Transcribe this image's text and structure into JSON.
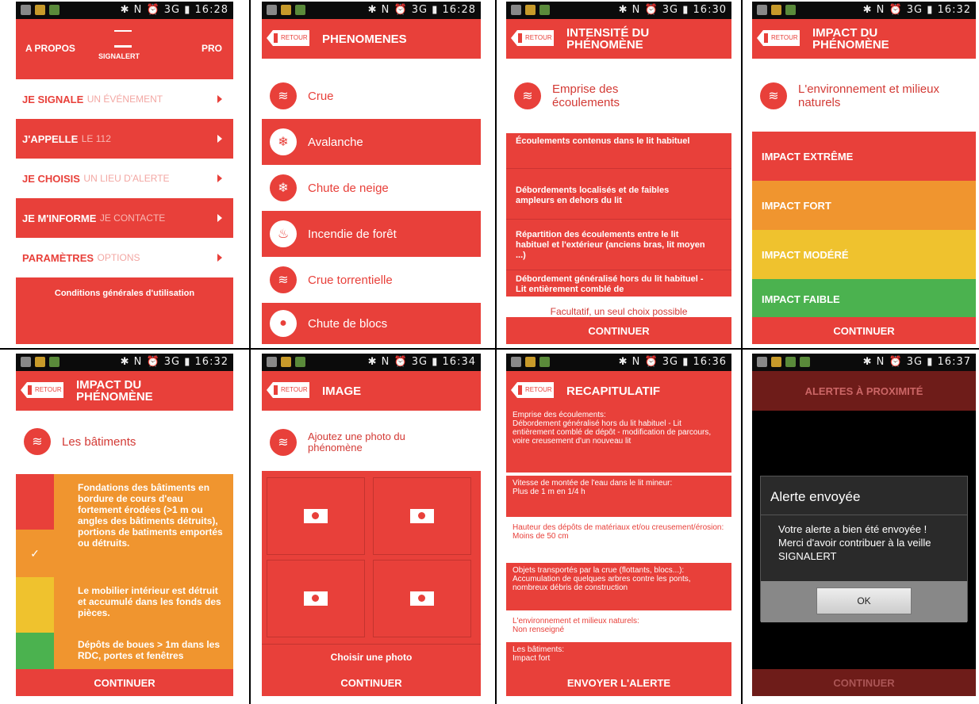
{
  "status_times": [
    "16:28",
    "16:28",
    "16:30",
    "16:32",
    "16:32",
    "16:34",
    "16:36",
    "16:37"
  ],
  "status_icons": "✱ N ⏰ 3G ▮ ",
  "retour": "RETOUR",
  "continue": "CONTINUER",
  "s1": {
    "left": "A PROPOS",
    "logo": "SIGNALERT",
    "right": "PRO",
    "menu": [
      {
        "main": "JE SIGNALE",
        "sub": "UN ÉVÉNEMENT",
        "style": "white"
      },
      {
        "main": "J'APPELLE",
        "sub": "LE 112",
        "style": "red"
      },
      {
        "main": "JE CHOISIS",
        "sub": "UN LIEU D'ALERTE",
        "style": "white"
      },
      {
        "main": "JE M'INFORME",
        "sub": "JE CONTACTE",
        "style": "red"
      },
      {
        "main": "PARAMÈTRES",
        "sub": "OPTIONS",
        "style": "white"
      }
    ],
    "footer": "Conditions générales d'utilisation"
  },
  "s2": {
    "title": "PHENOMENES",
    "items": [
      "Crue",
      "Avalanche",
      "Chute de neige",
      "Incendie de forêt",
      "Crue torrentielle",
      "Chute de blocs"
    ]
  },
  "s3": {
    "title": "INTENSITÉ DU PHÉNOMÈNE",
    "subtitle": "Emprise des écoulements",
    "options": [
      "Écoulements contenus dans le lit habituel",
      "Débordements localisés et de faibles ampleurs en dehors du lit",
      "Répartition des écoulements entre le lit habituel et l'extérieur (anciens bras, lit moyen ...)",
      "Débordement généralisé hors du lit habituel - Lit entièrement comblé de"
    ],
    "note": "Facultatif, un seul choix possible"
  },
  "s4": {
    "title": "IMPACT DU PHÉNOMÈNE",
    "subtitle": "L'environnement et milieux naturels",
    "levels": [
      {
        "label": "IMPACT EXTRÊME",
        "color": "#e8403a"
      },
      {
        "label": "IMPACT FORT",
        "color": "#f0952f"
      },
      {
        "label": "IMPACT MODÉRÉ",
        "color": "#efc22e"
      },
      {
        "label": "IMPACT FAIBLE",
        "color": "#4bb24f"
      }
    ]
  },
  "s5": {
    "title": "IMPACT DU PHÉNOMÈNE",
    "subtitle": "Les bâtiments",
    "check": "✓",
    "texts": [
      "Fondations des bâtiments en bordure de cours d'eau fortement érodées (>1 m ou angles des bâtiments détruits), portions de batiments emportés ou détruits.",
      "Le mobilier intérieur est détruit et accumulé dans les fonds des pièces.",
      "Dépôts de boues > 1m dans les RDC, portes et fenêtres"
    ],
    "colors": [
      "#e8403a",
      "#f0952f",
      "#efc22e",
      "#4bb24f"
    ]
  },
  "s6": {
    "title": "IMAGE",
    "subtitle": "Ajoutez une photo du phénomène",
    "choose": "Choisir une photo"
  },
  "s7": {
    "title": "RECAPITULATIF",
    "head_cut": "Emprise des écoulements:",
    "items": [
      {
        "style": "red",
        "label": "Débordement généralisé hors du lit habituel - Lit entièrement comblé de dépôt - modification de parcours, voire creusement d'un nouveau lit",
        "value": ""
      },
      {
        "style": "red",
        "label": "Vitesse de montée de l'eau dans le lit mineur:",
        "value": "Plus de 1 m en 1/4 h"
      },
      {
        "style": "white",
        "label": "Hauteur des dépôts de matériaux et/ou creusement/érosion:",
        "value": "Moins de 50 cm"
      },
      {
        "style": "red",
        "label": "Objets transportés par la crue (flottants, blocs...):",
        "value": "Accumulation de quelques arbres contre les ponts, nombreux débris de construction"
      },
      {
        "style": "white",
        "label": "L'environnement et milieux naturels:",
        "value": "Non renseigné"
      },
      {
        "style": "red",
        "label": "Les bâtiments:",
        "value": "Impact fort"
      }
    ],
    "send": "ENVOYER L'ALERTE"
  },
  "s8": {
    "header": "ALERTES À PROXIMITÉ",
    "dlg_title": "Alerte envoyée",
    "dlg_msg": "Votre alerte a bien été envoyée ! Merci d'avoir contribuer à la veille SIGNALERT",
    "ok": "OK"
  }
}
